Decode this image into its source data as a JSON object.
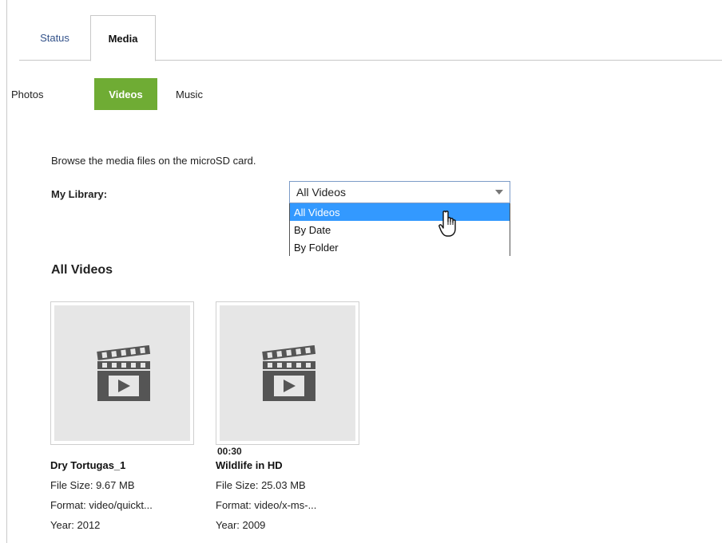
{
  "top_tabs": {
    "status": "Status",
    "media": "Media"
  },
  "sub_tabs": {
    "photos": "Photos",
    "videos": "Videos",
    "music": "Music"
  },
  "intro": "Browse the media files on the microSD card.",
  "library": {
    "label": "My Library:",
    "selected": "All Videos",
    "options": [
      "All Videos",
      "By Date",
      "By Folder"
    ]
  },
  "section_title": "All Videos",
  "videos": [
    {
      "duration": "",
      "title": "Dry Tortugas_1",
      "size": "File Size: 9.67 MB",
      "format": "Format: video/quickt...",
      "year": "Year: 2012",
      "icon": "film-clapper-play-icon"
    },
    {
      "duration": "00:30",
      "title": "Wildlife in HD",
      "size": "File Size: 25.03 MB",
      "format": "Format: video/x-ms-...",
      "year": "Year: 2009",
      "icon": "film-clapper-play-icon"
    }
  ],
  "colors": {
    "accent": "#6fac34",
    "selection": "#3399ff",
    "link": "#33528a"
  }
}
